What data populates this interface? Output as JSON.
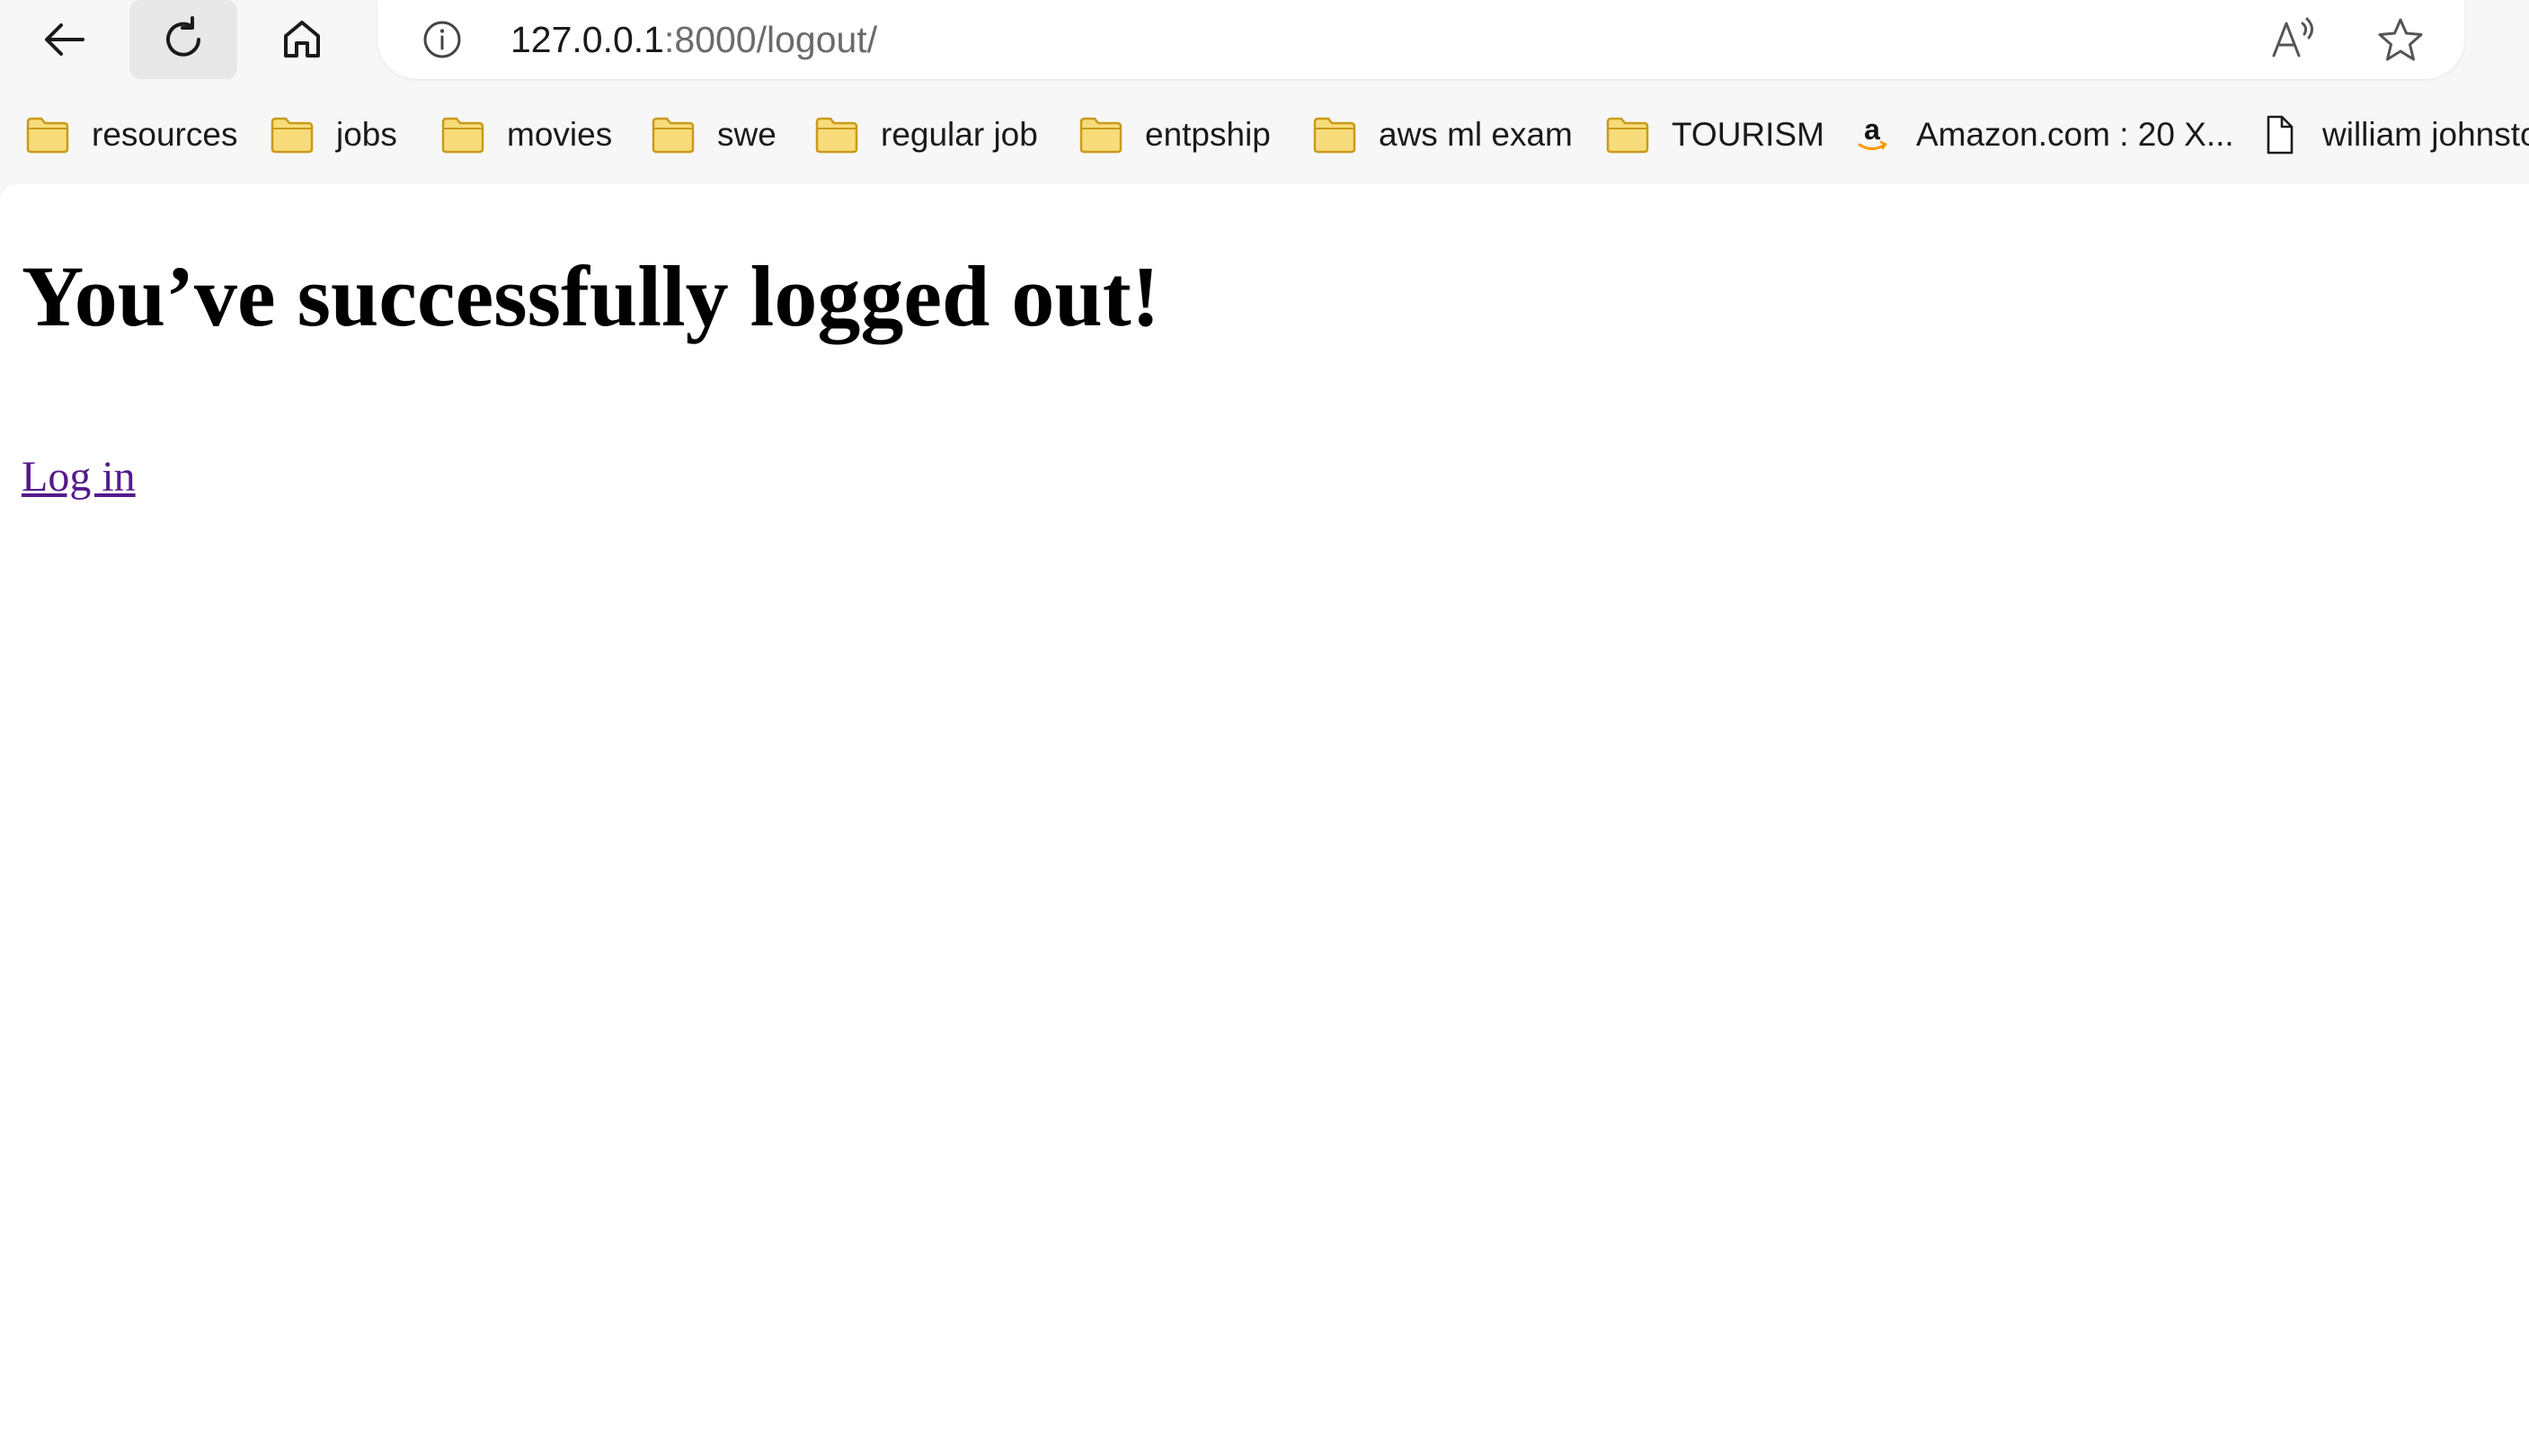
{
  "browser": {
    "address_bar": {
      "url_host": "127.0.0.1",
      "url_path": ":8000/logout/"
    },
    "icons": {
      "back": "back-arrow-icon",
      "refresh": "refresh-icon",
      "home": "home-icon",
      "site_info": "info-icon",
      "read_aloud": "read-aloud-icon",
      "favorite": "star-icon"
    },
    "bookmarks": [
      {
        "label": "resources",
        "icon": "folder-icon"
      },
      {
        "label": "jobs",
        "icon": "folder-icon"
      },
      {
        "label": "movies",
        "icon": "folder-icon"
      },
      {
        "label": "swe",
        "icon": "folder-icon"
      },
      {
        "label": "regular job",
        "icon": "folder-icon"
      },
      {
        "label": "entpship",
        "icon": "folder-icon"
      },
      {
        "label": "aws ml exam",
        "icon": "folder-icon"
      },
      {
        "label": "TOURISM",
        "icon": "folder-icon"
      },
      {
        "label": "Amazon.com : 20 X...",
        "icon": "amazon-icon"
      },
      {
        "label": "william johnsto",
        "icon": "document-icon"
      }
    ]
  },
  "page": {
    "heading": "You’ve successfully logged out!",
    "login_link": "Log in"
  },
  "colors": {
    "folder_fill": "#f8dc7b",
    "folder_stroke": "#c99a1c",
    "visited_link": "#551a8b",
    "amazon_orange": "#ff9900"
  }
}
